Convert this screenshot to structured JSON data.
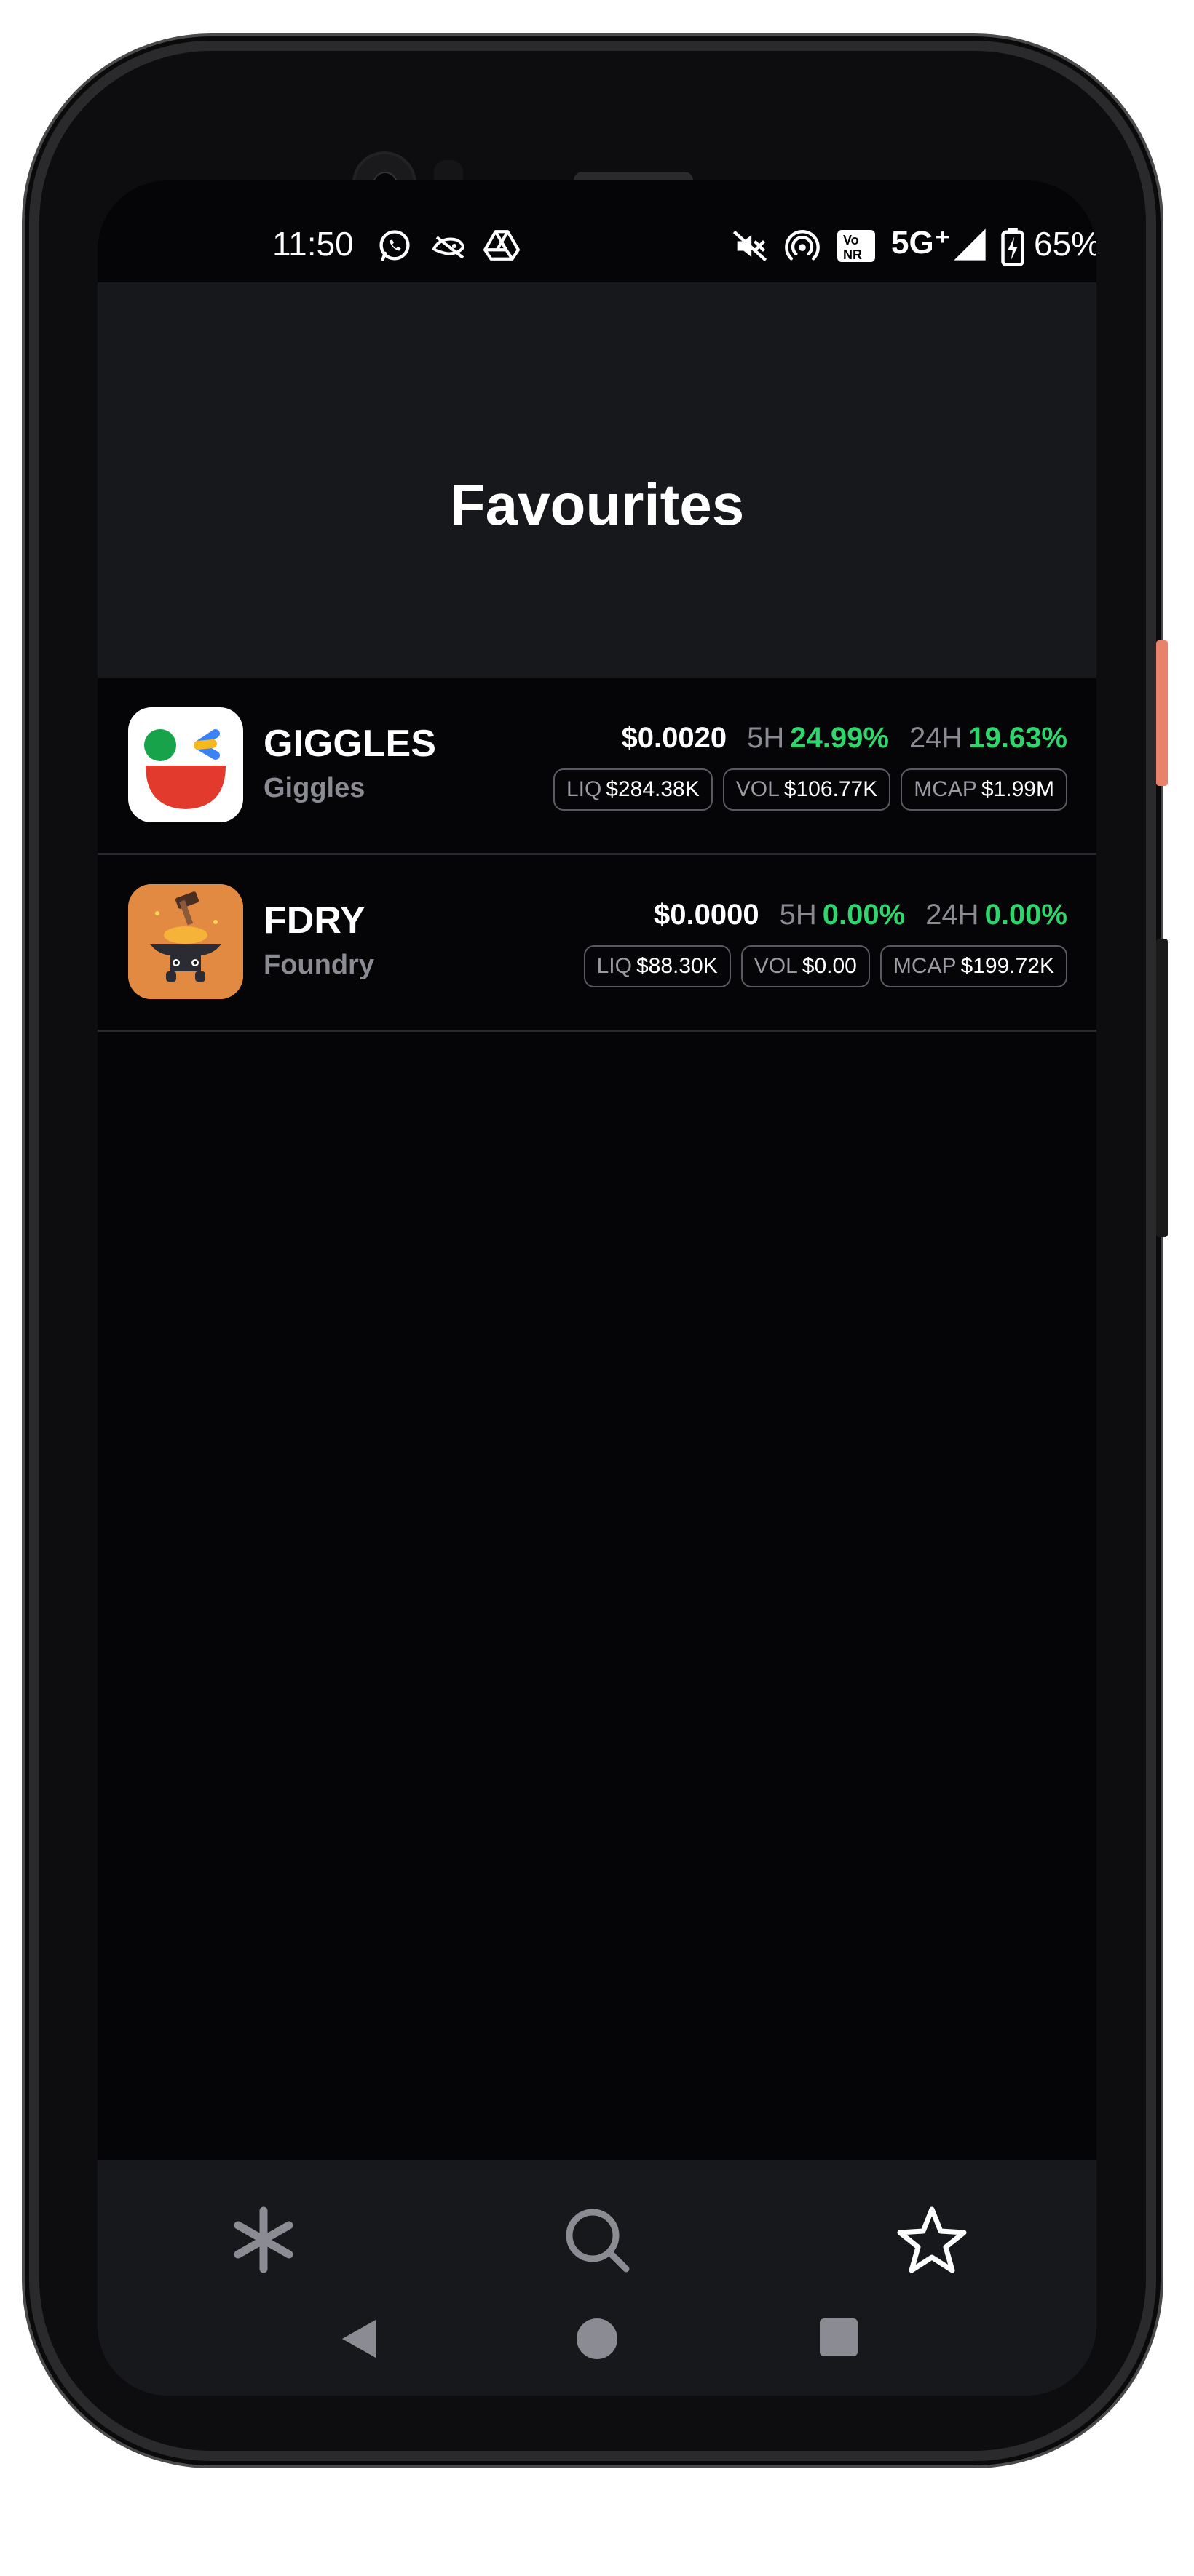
{
  "status_bar": {
    "time": "11:50",
    "network": "5G⁺",
    "battery": "65%",
    "icons": [
      "whatsapp-icon",
      "bird-icon",
      "drive-icon",
      "mute-icon",
      "hotspot-icon",
      "vonr-icon",
      "signal-icon",
      "battery-charging-icon"
    ]
  },
  "header": {
    "title": "Favourites"
  },
  "tokens": [
    {
      "symbol": "GIGGLES",
      "name": "Giggles",
      "price": "$0.0020",
      "h5_label": "5H",
      "h5_value": "24.99%",
      "h24_label": "24H",
      "h24_value": "19.63%",
      "liq_label": "LIQ",
      "liq_value": "$284.38K",
      "vol_label": "VOL",
      "vol_value": "$106.77K",
      "mcap_label": "MCAP",
      "mcap_value": "$1.99M"
    },
    {
      "symbol": "FDRY",
      "name": "Foundry",
      "price": "$0.0000",
      "h5_label": "5H",
      "h5_value": "0.00%",
      "h24_label": "24H",
      "h24_value": "0.00%",
      "liq_label": "LIQ",
      "liq_value": "$88.30K",
      "vol_label": "VOL",
      "vol_value": "$0.00",
      "mcap_label": "MCAP",
      "mcap_value": "$199.72K"
    }
  ],
  "bottom_nav": {
    "items": [
      "asterisk-icon",
      "search-icon",
      "star-icon"
    ],
    "active": "star-icon"
  },
  "colors": {
    "positive": "#2fd66e",
    "muted": "#8b8c93",
    "panel": "#17181c",
    "background": "#050507"
  }
}
